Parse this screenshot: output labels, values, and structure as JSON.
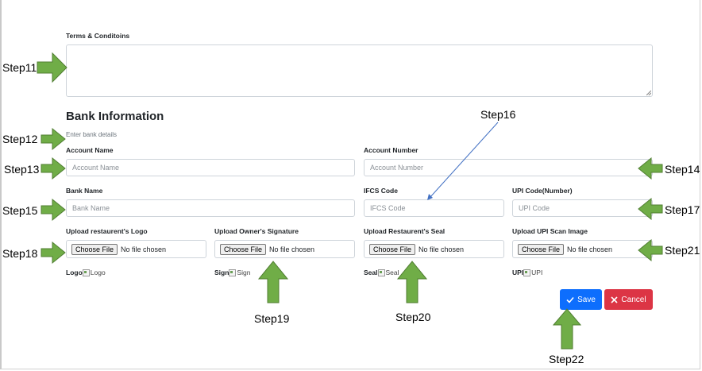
{
  "terms": {
    "label": "Terms & Conditoins",
    "value": ""
  },
  "bank": {
    "heading": "Bank Information",
    "subtitle": "Enter bank details",
    "account_name": {
      "label": "Account Name",
      "placeholder": "Account Name"
    },
    "account_number": {
      "label": "Account Number",
      "placeholder": "Account Number"
    },
    "bank_name": {
      "label": "Bank Name",
      "placeholder": "Bank Name"
    },
    "ifcs_code": {
      "label": "IFCS Code",
      "placeholder": "IFCS Code"
    },
    "upi_code": {
      "label": "UPI Code(Number)",
      "placeholder": "UPI Code"
    }
  },
  "uploads": [
    {
      "label": "Upload restaurent's Logo",
      "button": "Choose File",
      "status": "No file chosen",
      "preview_label": "Logo",
      "preview_alt": "Logo"
    },
    {
      "label": "Upload Owner's Signature",
      "button": "Choose File",
      "status": "No file chosen",
      "preview_label": "Sign",
      "preview_alt": "Sign"
    },
    {
      "label": "Upload Restaurent's Seal",
      "button": "Choose File",
      "status": "No file chosen",
      "preview_label": "Seal",
      "preview_alt": "Seal"
    },
    {
      "label": "Upload UPI Scan Image",
      "button": "Choose File",
      "status": "No file chosen",
      "preview_label": "UPI",
      "preview_alt": "UPI"
    }
  ],
  "actions": {
    "save": "Save",
    "cancel": "Cancel"
  },
  "colors": {
    "primary": "#0d6efd",
    "danger": "#dc3545",
    "annotation_arrow": "#70ad47"
  },
  "annotations": {
    "step11": "Step11",
    "step12": "Step12",
    "step13": "Step13",
    "step14": "Step14",
    "step15": "Step15",
    "step16": "Step16",
    "step17": "Step17",
    "step18": "Step18",
    "step19": "Step19",
    "step20": "Step20",
    "step21": "Step21",
    "step22": "Step22"
  }
}
